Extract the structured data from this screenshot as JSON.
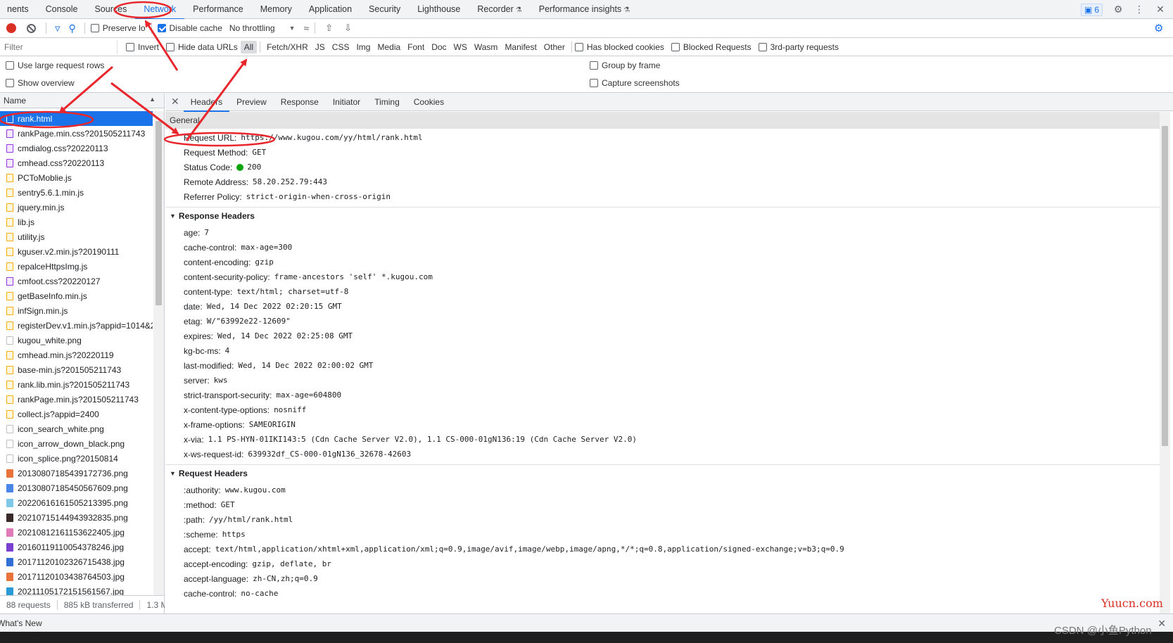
{
  "tabs": [
    {
      "label": "nents",
      "active": false,
      "flask": false
    },
    {
      "label": "Console",
      "active": false,
      "flask": false
    },
    {
      "label": "Sources",
      "active": false,
      "flask": false
    },
    {
      "label": "Network",
      "active": true,
      "flask": false
    },
    {
      "label": "Performance",
      "active": false,
      "flask": false
    },
    {
      "label": "Memory",
      "active": false,
      "flask": false
    },
    {
      "label": "Application",
      "active": false,
      "flask": false
    },
    {
      "label": "Security",
      "active": false,
      "flask": false
    },
    {
      "label": "Lighthouse",
      "active": false,
      "flask": false
    },
    {
      "label": "Recorder",
      "active": false,
      "flask": true
    },
    {
      "label": "Performance insights",
      "active": false,
      "flask": true
    }
  ],
  "header_right": {
    "issues_count": "6"
  },
  "toolbar": {
    "preserve_log_label": "Preserve lo",
    "disable_cache_label": "Disable cache",
    "throttling_label": "No throttling"
  },
  "filterbar": {
    "filter_placeholder": "Filter",
    "invert_label": "Invert",
    "hide_data_urls_label": "Hide data URLs",
    "types": [
      "All",
      "Fetch/XHR",
      "JS",
      "CSS",
      "Img",
      "Media",
      "Font",
      "Doc",
      "WS",
      "Wasm",
      "Manifest",
      "Other"
    ],
    "has_blocked_cookies_label": "Has blocked cookies",
    "blocked_requests_label": "Blocked Requests",
    "third_party_label": "3rd-party requests"
  },
  "settings": {
    "large_rows_label": "Use large request rows",
    "show_overview_label": "Show overview",
    "group_by_frame_label": "Group by frame",
    "capture_screenshots_label": "Capture screenshots"
  },
  "requests": {
    "column_name": "Name",
    "items": [
      {
        "name": "rank.html",
        "type": "doc",
        "selected": true
      },
      {
        "name": "rankPage.min.css?201505211743",
        "type": "css"
      },
      {
        "name": "cmdialog.css?20220113",
        "type": "css"
      },
      {
        "name": "cmhead.css?20220113",
        "type": "css"
      },
      {
        "name": "PCToMoblie.js",
        "type": "js"
      },
      {
        "name": "sentry5.6.1.min.js",
        "type": "js"
      },
      {
        "name": "jquery.min.js",
        "type": "js"
      },
      {
        "name": "lib.js",
        "type": "js"
      },
      {
        "name": "utility.js",
        "type": "js"
      },
      {
        "name": "kguser.v2.min.js?20190111",
        "type": "js"
      },
      {
        "name": "repalceHttpsImg.js",
        "type": "js"
      },
      {
        "name": "cmfoot.css?20220127",
        "type": "css"
      },
      {
        "name": "getBaseInfo.min.js",
        "type": "js"
      },
      {
        "name": "infSign.min.js",
        "type": "js"
      },
      {
        "name": "registerDev.v1.min.js?appid=1014&2",
        "type": "js"
      },
      {
        "name": "kugou_white.png",
        "type": "img"
      },
      {
        "name": "cmhead.min.js?20220119",
        "type": "js"
      },
      {
        "name": "base-min.js?201505211743",
        "type": "js"
      },
      {
        "name": "rank.lib.min.js?201505211743",
        "type": "js"
      },
      {
        "name": "rankPage.min.js?201505211743",
        "type": "js"
      },
      {
        "name": "collect.js?appid=2400",
        "type": "js"
      },
      {
        "name": "icon_search_white.png",
        "type": "img"
      },
      {
        "name": "icon_arrow_down_black.png",
        "type": "img"
      },
      {
        "name": "icon_splice.png?20150814",
        "type": "img"
      },
      {
        "name": "20130807185439172736.png",
        "type": "pic",
        "color": "#e8743b"
      },
      {
        "name": "20130807185450567609.png",
        "type": "pic",
        "color": "#4a86e8"
      },
      {
        "name": "20220616161505213395.png",
        "type": "pic",
        "color": "#7fc8e8"
      },
      {
        "name": "20210715144943932835.png",
        "type": "pic",
        "color": "#3a2a2a"
      },
      {
        "name": "20210812161153622405.jpg",
        "type": "pic",
        "color": "#e07ab8"
      },
      {
        "name": "20160119110054378246.jpg",
        "type": "pic",
        "color": "#7a3fd1"
      },
      {
        "name": "20171120102326715438.jpg",
        "type": "pic",
        "color": "#2f6fd6"
      },
      {
        "name": "20171120103438764503.jpg",
        "type": "pic",
        "color": "#e8743b"
      },
      {
        "name": "20211105172151561567.jpg",
        "type": "pic",
        "color": "#2a9ad6"
      }
    ],
    "status": {
      "requests": "88 requests",
      "transferred": "885 kB transferred",
      "resources": "1.3 M"
    }
  },
  "detail": {
    "tabs": [
      "Headers",
      "Preview",
      "Response",
      "Initiator",
      "Timing",
      "Cookies"
    ],
    "active_tab": "Headers",
    "general": {
      "title": "General",
      "rows": [
        {
          "k": "Request URL:",
          "v": "https://www.kugou.com/yy/html/rank.html"
        },
        {
          "k": "Request Method:",
          "v": "GET"
        },
        {
          "k": "Status Code:",
          "v": "200",
          "dot": true
        },
        {
          "k": "Remote Address:",
          "v": "58.20.252.79:443"
        },
        {
          "k": "Referrer Policy:",
          "v": "strict-origin-when-cross-origin"
        }
      ]
    },
    "response_headers": {
      "title": "Response Headers",
      "rows": [
        {
          "k": "age:",
          "v": "7"
        },
        {
          "k": "cache-control:",
          "v": "max-age=300"
        },
        {
          "k": "content-encoding:",
          "v": "gzip"
        },
        {
          "k": "content-security-policy:",
          "v": "frame-ancestors 'self' *.kugou.com"
        },
        {
          "k": "content-type:",
          "v": "text/html; charset=utf-8"
        },
        {
          "k": "date:",
          "v": "Wed, 14 Dec 2022 02:20:15 GMT"
        },
        {
          "k": "etag:",
          "v": "W/\"63992e22-12609\""
        },
        {
          "k": "expires:",
          "v": "Wed, 14 Dec 2022 02:25:08 GMT"
        },
        {
          "k": "kg-bc-ms:",
          "v": "4"
        },
        {
          "k": "last-modified:",
          "v": "Wed, 14 Dec 2022 02:00:02 GMT"
        },
        {
          "k": "server:",
          "v": "kws"
        },
        {
          "k": "strict-transport-security:",
          "v": "max-age=604800"
        },
        {
          "k": "x-content-type-options:",
          "v": "nosniff"
        },
        {
          "k": "x-frame-options:",
          "v": "SAMEORIGIN"
        },
        {
          "k": "x-via:",
          "v": "1.1 PS-HYN-01IKI143:5 (Cdn Cache Server V2.0), 1.1 CS-000-01gN136:19 (Cdn Cache Server V2.0)"
        },
        {
          "k": "x-ws-request-id:",
          "v": "639932df_CS-000-01gN136_32678-42603"
        }
      ]
    },
    "request_headers": {
      "title": "Request Headers",
      "rows": [
        {
          "k": ":authority:",
          "v": "www.kugou.com"
        },
        {
          "k": ":method:",
          "v": "GET"
        },
        {
          "k": ":path:",
          "v": "/yy/html/rank.html"
        },
        {
          "k": ":scheme:",
          "v": "https"
        },
        {
          "k": "accept:",
          "v": "text/html,application/xhtml+xml,application/xml;q=0.9,image/avif,image/webp,image/apng,*/*;q=0.8,application/signed-exchange;v=b3;q=0.9"
        },
        {
          "k": "accept-encoding:",
          "v": "gzip, deflate, br"
        },
        {
          "k": "accept-language:",
          "v": "zh-CN,zh;q=0.9"
        },
        {
          "k": "cache-control:",
          "v": "no-cache"
        }
      ]
    }
  },
  "drawer": {
    "label": "What's New"
  },
  "watermarks": {
    "site": "Yuucn.com",
    "author": "CSDN @小鱼Python"
  },
  "colors": {
    "accent": "#1a73e8",
    "annotation": "#e8262b",
    "status_ok": "#0ca30c"
  }
}
